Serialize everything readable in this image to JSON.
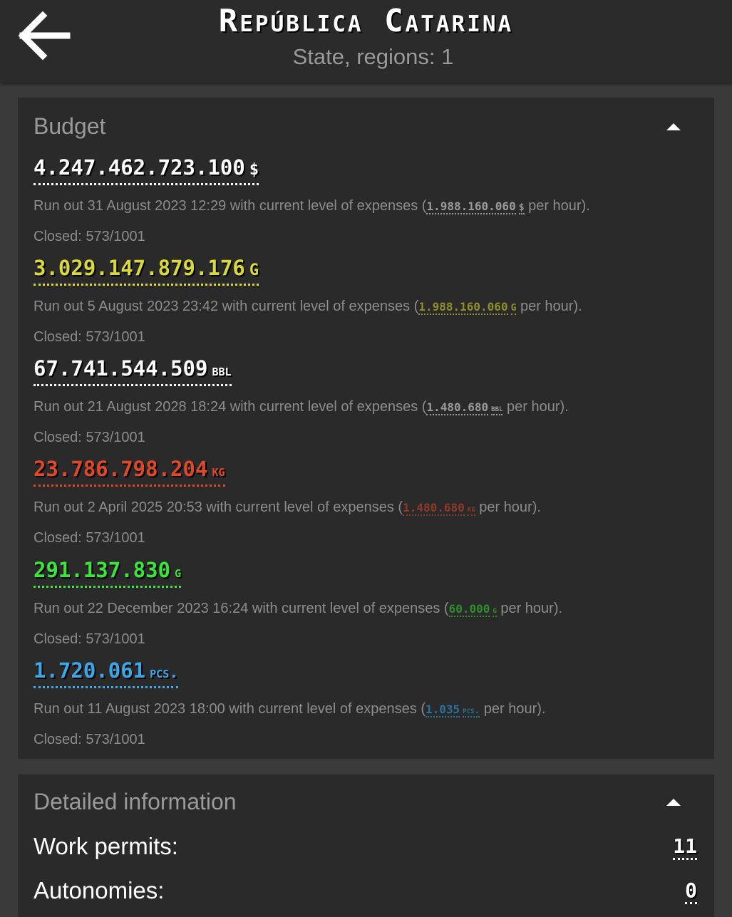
{
  "header": {
    "title": "República Catarina",
    "subtitle": "State, regions: 1",
    "back_icon": "arrow-left-icon"
  },
  "budget": {
    "title": "Budget",
    "collapse_icon": "chevron-up-icon",
    "resources": [
      {
        "amount": "4.247.462.723.100",
        "unit": "$",
        "runout_prefix": "Run out 31 August 2023 12:29 with current level of expenses (",
        "rate": "1.988.160.060",
        "rate_unit": "$",
        "runout_suffix": " per hour).",
        "closed": "Closed: 573/1001",
        "color": "#ffffff"
      },
      {
        "amount": "3.029.147.879.176",
        "unit": "G",
        "runout_prefix": "Run out 5 August 2023 23:42 with current level of expenses (",
        "rate": "1.988.160.060",
        "rate_unit": "G",
        "runout_suffix": " per hour).",
        "closed": "Closed: 573/1001",
        "color": "#d9d93a"
      },
      {
        "amount": "67.741.544.509",
        "unit": "bbl",
        "runout_prefix": "Run out 21 August 2028 18:24 with current level of expenses (",
        "rate": "1.480.680",
        "rate_unit": "bbl",
        "runout_suffix": " per hour).",
        "closed": "Closed: 573/1001",
        "color": "#ffffff"
      },
      {
        "amount": "23.786.798.204",
        "unit": "kg",
        "runout_prefix": "Run out 2 April 2025 20:53 with current level of expenses (",
        "rate": "1.480.680",
        "rate_unit": "kg",
        "runout_suffix": " per hour).",
        "closed": "Closed: 573/1001",
        "color": "#e04828"
      },
      {
        "amount": "291.137.830",
        "unit": "g",
        "runout_prefix": "Run out 22 December 2023 16:24 with current level of expenses (",
        "rate": "60.000",
        "rate_unit": "g",
        "runout_suffix": " per hour).",
        "closed": "Closed: 573/1001",
        "color": "#39e639"
      },
      {
        "amount": "1.720.061",
        "unit": "pcs.",
        "runout_prefix": "Run out 11 August 2023 18:00 with current level of expenses (",
        "rate": "1.035",
        "rate_unit": "pcs.",
        "runout_suffix": " per hour).",
        "closed": "Closed: 573/1001",
        "color": "#3ba8ea"
      }
    ]
  },
  "details": {
    "title": "Detailed information",
    "collapse_icon": "chevron-up-icon",
    "work_permits_label": "Work permits:",
    "work_permits_value": "11",
    "autonomies_label": "Autonomies:",
    "autonomies_value": "0"
  }
}
